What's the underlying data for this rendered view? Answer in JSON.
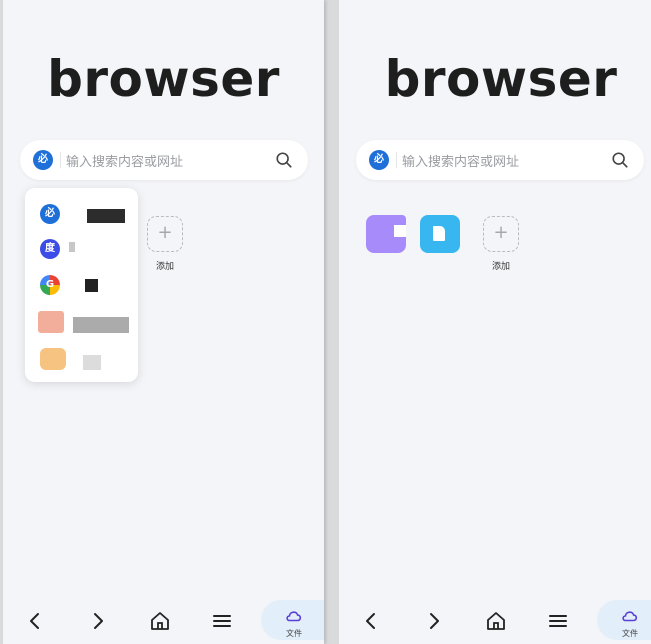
{
  "app": {
    "logo_text": "browser"
  },
  "search": {
    "placeholder": "输入搜索内容或网址",
    "engine_icon_glyph": "必",
    "engine_icon_color": "#1f6fd8"
  },
  "shortcuts": {
    "add_label": "添加",
    "add_glyph": "+"
  },
  "engine_dropdown": {
    "items": [
      {
        "icon": "biying-icon",
        "glyph": "必",
        "color": "#1f6fd8"
      },
      {
        "icon": "baidu-icon",
        "glyph": "度",
        "color": "#3b4de6"
      },
      {
        "icon": "google-icon",
        "glyph": "G",
        "color": "#e24a3b"
      },
      {
        "icon": "blurred-engine-icon",
        "glyph": "",
        "color": "#f0a08a"
      },
      {
        "icon": "blurred-engine-icon",
        "glyph": "",
        "color": "#f5b96a"
      }
    ]
  },
  "bottom_nav": {
    "files_label": "文件"
  },
  "colors": {
    "background": "#f4f5f9",
    "accent": "#1f6fd8",
    "tile_purple": "#a78bfa",
    "tile_blue": "#38b6f0",
    "files_bg": "#e2eefa"
  }
}
